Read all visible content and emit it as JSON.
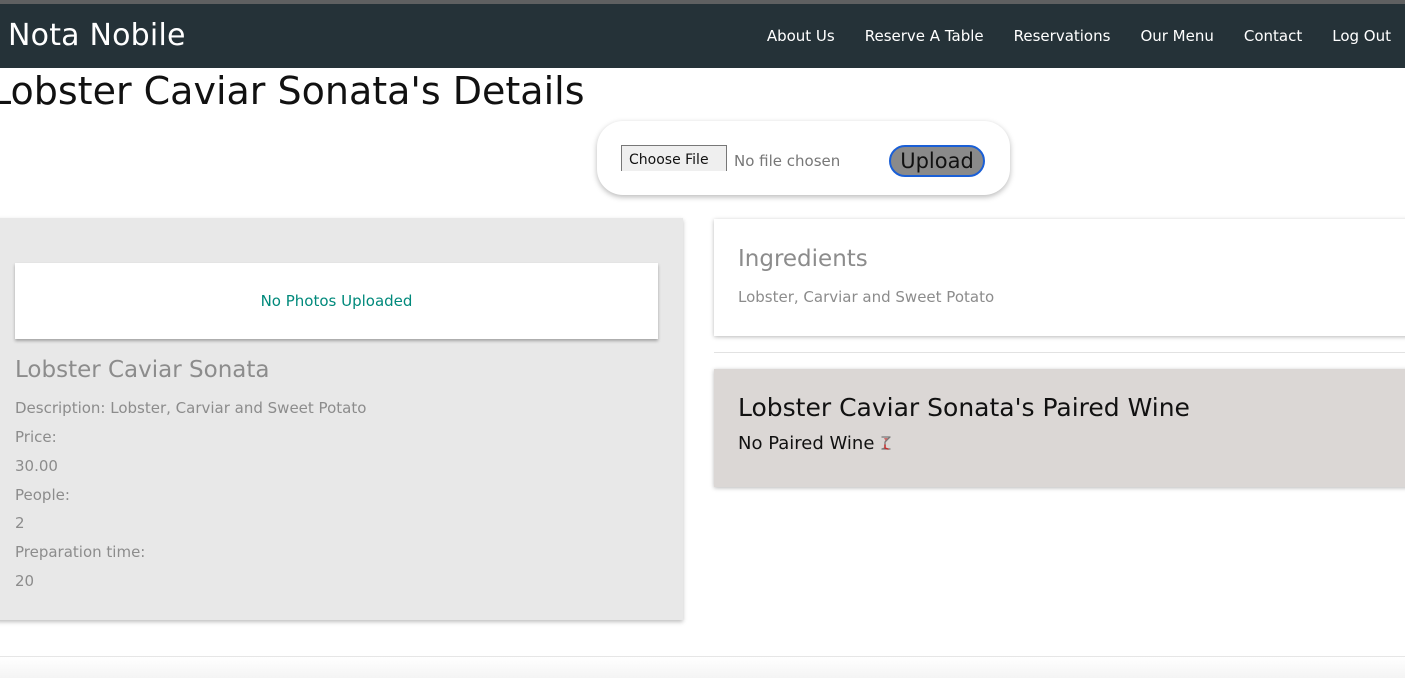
{
  "navbar": {
    "brand": "Nota Nobile",
    "links": [
      "About Us",
      "Reserve A Table",
      "Reservations",
      "Our Menu",
      "Contact",
      "Log Out"
    ]
  },
  "page": {
    "title": "Lobster Caviar Sonata's Details"
  },
  "upload": {
    "choose_label": "Choose File",
    "file_status": "No file chosen",
    "upload_label": "Upload"
  },
  "photos": {
    "empty_text": "No Photos Uploaded"
  },
  "item": {
    "name": "Lobster Caviar Sonata",
    "description": "Description: Lobster, Carviar and Sweet Potato",
    "price_label": "Price:",
    "price": "30.00",
    "people_label": "People:",
    "people": "2",
    "prep_label": "Preparation time:",
    "prep_time": "20"
  },
  "ingredients": {
    "title": "Ingredients",
    "text": "Lobster, Carviar and Sweet Potato"
  },
  "wine": {
    "title": "Lobster Caviar Sonata's Paired Wine",
    "none_text": "No Paired Wine",
    "icon": "wine-glass-icon"
  },
  "colors": {
    "navbar_bg": "#253238",
    "accent_teal": "#00897b",
    "upload_border": "#1a5fd6",
    "wine_card_bg": "#dbd7d5",
    "detail_card_bg": "#e8e8e8"
  }
}
